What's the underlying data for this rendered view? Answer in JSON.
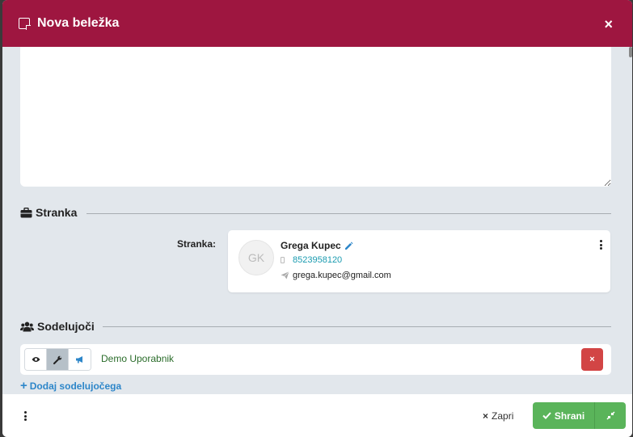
{
  "modal": {
    "title": "Nova beležka",
    "close_symbol": "×"
  },
  "note": {
    "value": ""
  },
  "client_section": {
    "heading": "Stranka",
    "field_label": "Stranka:",
    "client": {
      "initials": "GK",
      "name": "Grega Kupec",
      "phone": "8523958120",
      "email": "grega.kupec@gmail.com"
    }
  },
  "participants_section": {
    "heading": "Sodelujoči",
    "participants": [
      {
        "name": "Demo Uporabnik",
        "active_role": "wrench"
      }
    ],
    "remove_symbol": "×",
    "add_label": "Dodaj sodelujočega",
    "add_symbol": "+"
  },
  "footer": {
    "close_label": "Zapri",
    "close_symbol": "×",
    "save_label": "Shrani"
  },
  "colors": {
    "header": "#9e1640",
    "save": "#5ab45a",
    "remove": "#d24545",
    "link": "#2d86c9",
    "phone": "#1a9bb0",
    "participant_name": "#2a6c2a"
  },
  "icons": {
    "header": "sticky-note-icon",
    "client_section": "briefcase-icon",
    "participants_section": "users-icon",
    "edit": "pencil-icon",
    "phone": "mobile-icon",
    "email": "paper-plane-icon",
    "view": "eye-icon",
    "wrench": "wrench-icon",
    "notify": "bullhorn-icon",
    "save": "check-icon",
    "save_extra": "compress-icon"
  }
}
